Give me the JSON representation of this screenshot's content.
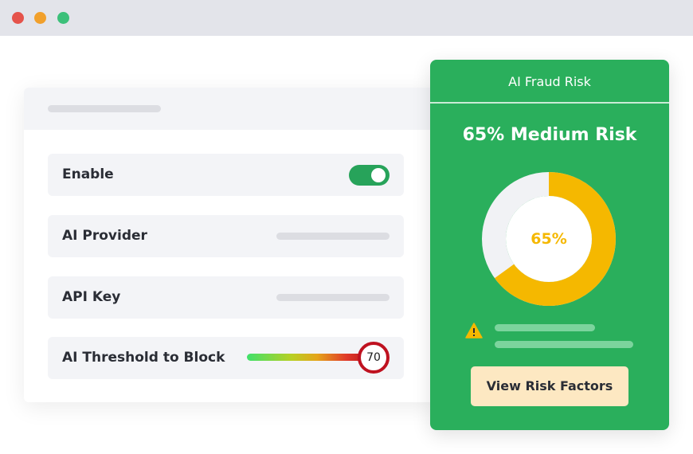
{
  "window": {
    "controls": [
      "close",
      "minimize",
      "maximize"
    ]
  },
  "settings": {
    "rows": [
      {
        "label": "Enable",
        "control": "toggle",
        "enabled": true
      },
      {
        "label": "AI Provider",
        "control": "placeholder"
      },
      {
        "label": "API Key",
        "control": "placeholder"
      },
      {
        "label": "AI Threshold to Block",
        "control": "slider",
        "value": "70"
      }
    ]
  },
  "risk": {
    "title": "AI Fraud Risk",
    "heading": "65% Medium Risk",
    "percent_label": "65%",
    "percent": 65,
    "button_label": "View Risk Factors",
    "icon": "warning-icon"
  },
  "colors": {
    "panel_green": "#2aaf5c",
    "gauge_yellow": "#f5b800",
    "toggle_on": "#27a35a",
    "threshold_ring": "#bf1220",
    "button_bg": "#fde8c2"
  }
}
